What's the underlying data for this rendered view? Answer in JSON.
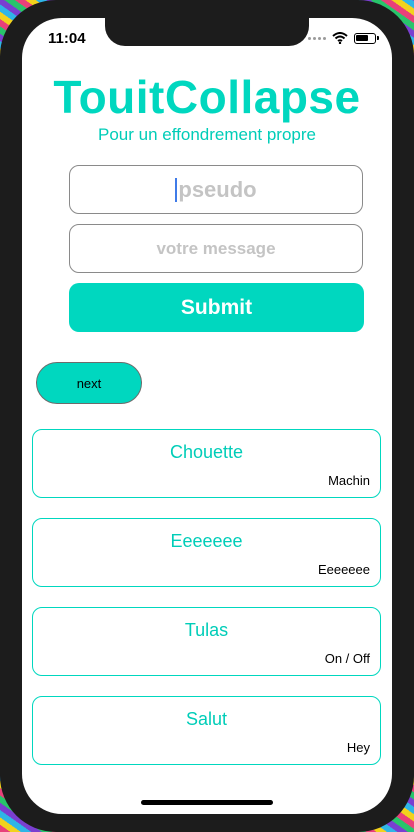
{
  "status_bar": {
    "time": "11:04"
  },
  "header": {
    "title": "TouitCollapse",
    "subtitle": "Pour un effondrement propre"
  },
  "form": {
    "pseudo_placeholder": "pseudo",
    "message_placeholder": "votre message",
    "submit_label": "Submit"
  },
  "pagination": {
    "next_label": "next"
  },
  "messages": [
    {
      "text": "Chouette",
      "author": "Machin"
    },
    {
      "text": "Eeeeeee",
      "author": "Eeeeeee"
    },
    {
      "text": "Tulas",
      "author": "On / Off"
    },
    {
      "text": "Salut",
      "author": "Hey"
    }
  ],
  "colors": {
    "accent": "#00d7bf",
    "frame": "#1c1c1c"
  },
  "icons": [
    "signal-dots-icon",
    "wifi-icon",
    "battery-icon"
  ]
}
